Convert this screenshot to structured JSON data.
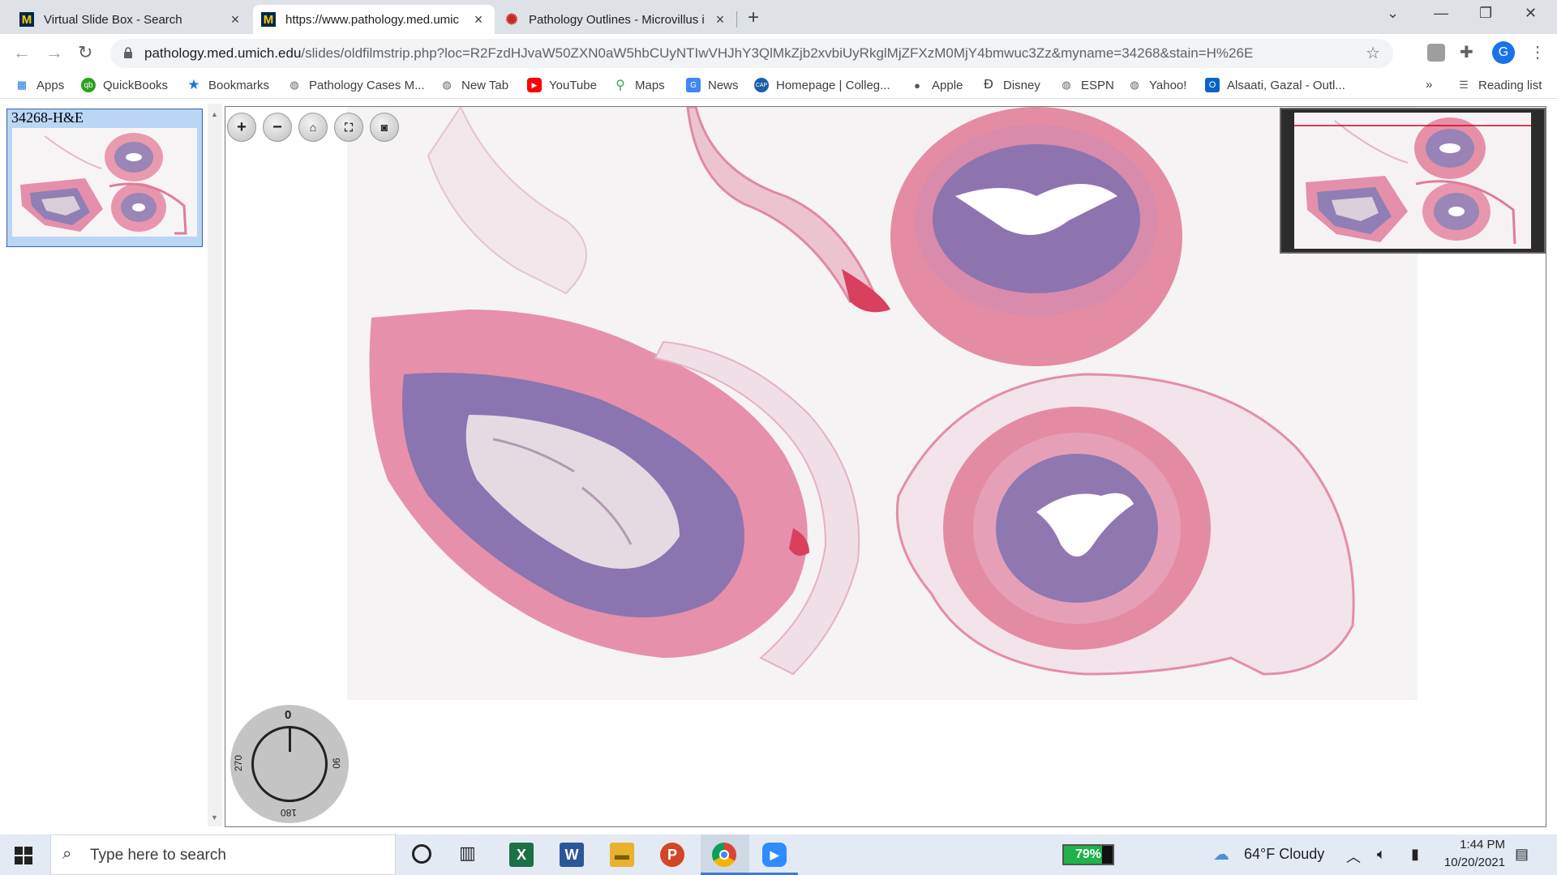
{
  "browser": {
    "tabs": [
      {
        "title": "Virtual Slide Box - Search",
        "icon": "umich-m-icon"
      },
      {
        "title": "https://www.pathology.med.umic",
        "icon": "umich-m-icon"
      },
      {
        "title": "Pathology Outlines - Microvillus i",
        "icon": "pathology-outlines-icon"
      }
    ],
    "url_host": "pathology.med.umich.edu",
    "url_path": "/slides/oldfilmstrip.php?loc=R2FzdHJvaW50ZXN0aW5hbCUyNTIwVHJhY3QlMkZjb2xvbiUyRkglMjZFXzM0MjY4bmwuc3Zz&myname=34268&stain=H%26E",
    "profile_initial": "G"
  },
  "bookmarks": [
    {
      "label": "Apps",
      "icon": "apps-grid-icon"
    },
    {
      "label": "QuickBooks",
      "icon": "quickbooks-icon"
    },
    {
      "label": "Bookmarks",
      "icon": "star-icon"
    },
    {
      "label": "Pathology Cases M...",
      "icon": "globe-icon"
    },
    {
      "label": "New Tab",
      "icon": "globe-icon"
    },
    {
      "label": "YouTube",
      "icon": "youtube-icon"
    },
    {
      "label": "Maps",
      "icon": "maps-icon"
    },
    {
      "label": "News",
      "icon": "news-icon"
    },
    {
      "label": "Homepage | Colleg...",
      "icon": "cap-icon"
    },
    {
      "label": "Apple",
      "icon": "apple-icon"
    },
    {
      "label": "Disney",
      "icon": "disney-icon"
    },
    {
      "label": "ESPN",
      "icon": "globe-icon"
    },
    {
      "label": "Yahoo!",
      "icon": "globe-icon"
    },
    {
      "label": "Alsaati, Gazal - Outl...",
      "icon": "outlook-icon"
    }
  ],
  "bookmarks_overflow": "»",
  "reading_list": "Reading list",
  "slide": {
    "thumb_title": "34268-H&E",
    "rotation_labels": {
      "top": "0",
      "right": "90",
      "bottom": "180",
      "left": "270"
    }
  },
  "taskbar": {
    "search_placeholder": "Type here to search",
    "battery": "79%",
    "weather": "64°F  Cloudy",
    "time": "1:44 PM",
    "date": "10/20/2021"
  }
}
